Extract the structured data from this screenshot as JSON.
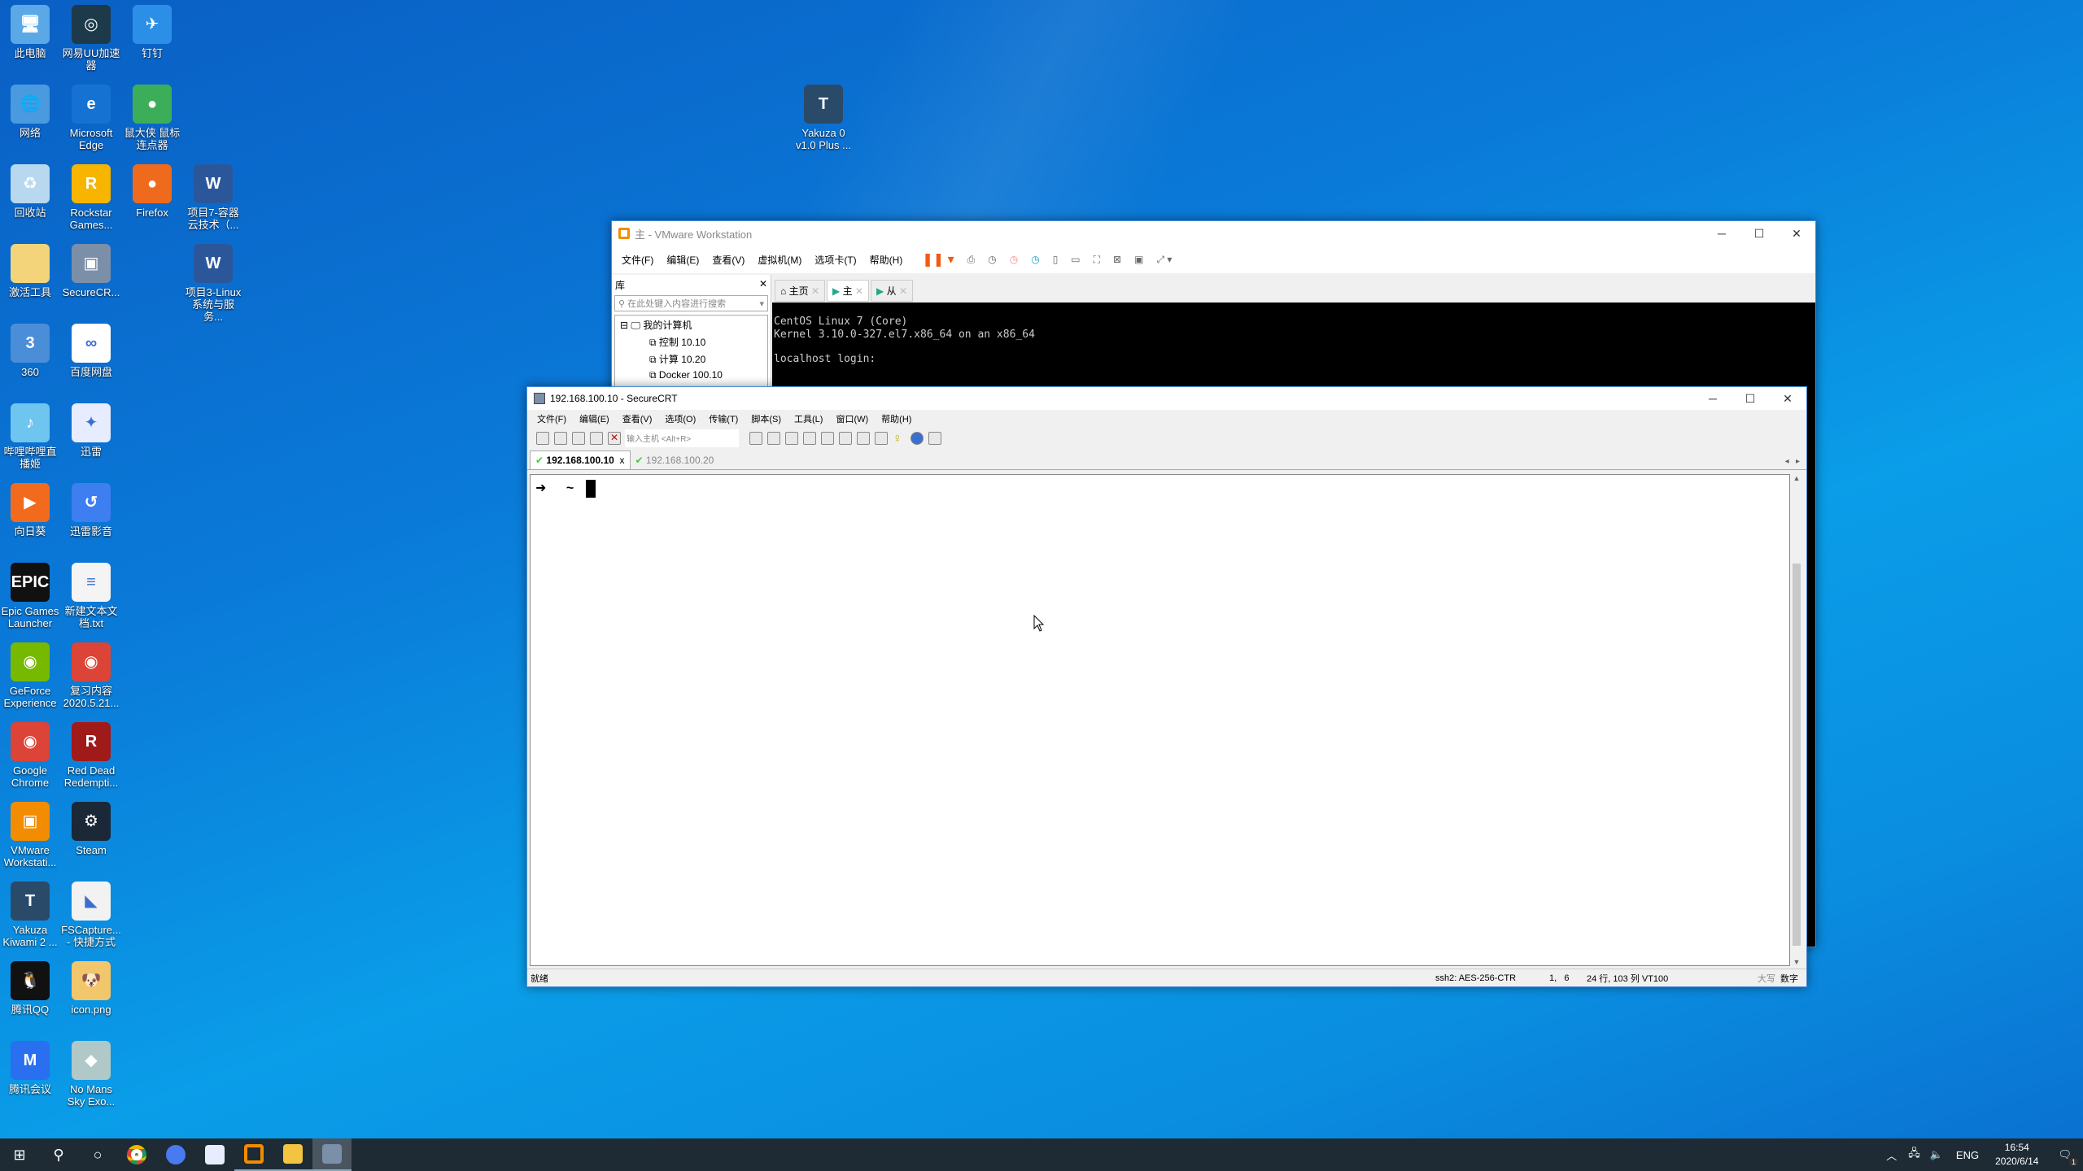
{
  "desktop": {
    "icons": [
      {
        "label": "此电脑",
        "color": "#5aa9e6",
        "glyph": "🖥"
      },
      {
        "label": "网易UU加速器",
        "color": "#1d3a4a",
        "glyph": "◎"
      },
      {
        "label": "钉钉",
        "color": "#2b8fe8",
        "glyph": "✈"
      },
      {
        "label": "网络",
        "color": "#4a9ae0",
        "glyph": "🌐"
      },
      {
        "label": "Microsoft Edge",
        "color": "#1572d3",
        "glyph": "e"
      },
      {
        "label": "鼠大侠 鼠标连点器",
        "color": "#3cae5a",
        "glyph": "●"
      },
      {
        "label": "回收站",
        "color": "#b8d8f0",
        "glyph": "♻"
      },
      {
        "label": "Rockstar Games...",
        "color": "#f7b500",
        "glyph": "R"
      },
      {
        "label": "Firefox",
        "color": "#f06a1d",
        "glyph": "●"
      },
      {
        "label": "项目7-容器云技术（...",
        "color": "#2b579a",
        "glyph": "W"
      },
      {
        "label": "激活工具",
        "color": "#f3d47a",
        "glyph": ""
      },
      {
        "label": "SecureCR...",
        "color": "#7c8fa8",
        "glyph": "▣"
      },
      {
        "label": "项目3-Linux系统与服务...",
        "color": "#2b579a",
        "glyph": "W"
      },
      {
        "label": "360",
        "color": "#4a8ed8",
        "glyph": "3"
      },
      {
        "label": "百度网盘",
        "color": "#ffffff",
        "glyph": "∞"
      },
      {
        "label": "哔哩哔哩直播姬",
        "color": "#6ec6f0",
        "glyph": "♪"
      },
      {
        "label": "迅雷",
        "color": "#e8ecff",
        "glyph": "✦"
      },
      {
        "label": "向日葵",
        "color": "#f26b1d",
        "glyph": "▶"
      },
      {
        "label": "迅雷影音",
        "color": "#3d7ef0",
        "glyph": "↺"
      },
      {
        "label": "Epic Games Launcher",
        "color": "#111111",
        "glyph": "EPIC"
      },
      {
        "label": "新建文本文档.txt",
        "color": "#f4f4f4",
        "glyph": "≡"
      },
      {
        "label": "GeForce Experience",
        "color": "#76b900",
        "glyph": "◉"
      },
      {
        "label": "复习内容2020.5.21...",
        "color": "#db4437",
        "glyph": "◉"
      },
      {
        "label": "Google Chrome",
        "color": "#db4437",
        "glyph": "◉"
      },
      {
        "label": "Red Dead Redempti...",
        "color": "#a11a1a",
        "glyph": "R"
      },
      {
        "label": "VMware Workstati...",
        "color": "#f28c00",
        "glyph": "▣"
      },
      {
        "label": "Steam",
        "color": "#1b2838",
        "glyph": "⚙"
      },
      {
        "label": "Yakuza Kiwami 2 ...",
        "color": "#2a4a6a",
        "glyph": "T"
      },
      {
        "label": "FSCapture... - 快捷方式",
        "color": "#f2f2f2",
        "glyph": "◣"
      },
      {
        "label": "腾讯QQ",
        "color": "#111111",
        "glyph": "🐧"
      },
      {
        "label": "icon.png",
        "color": "#f2c66b",
        "glyph": "🐶"
      },
      {
        "label": "腾讯会议",
        "color": "#2a6ff0",
        "glyph": "M"
      },
      {
        "label": "No Mans Sky Exo...",
        "color": "#b0c8c8",
        "glyph": "◆"
      },
      {
        "label": "Yakuza 0 v1.0 Plus ...",
        "color": "#2a4a6a",
        "glyph": "T"
      }
    ]
  },
  "vmware": {
    "title": "主 - VMware Workstation",
    "menu": [
      "文件(F)",
      "编辑(E)",
      "查看(V)",
      "虚拟机(M)",
      "选项卡(T)",
      "帮助(H)"
    ],
    "library_title": "库",
    "search_placeholder": "在此处键入内容进行搜索",
    "tree_root": "我的计算机",
    "tree_items": [
      "控制 10.10",
      "计算 10.20",
      "Docker 100.10"
    ],
    "tabs": [
      "主页",
      "主",
      "从"
    ],
    "console": [
      "CentOS Linux 7 (Core)",
      "Kernel 3.10.0-327.el7.x86_64 on an x86_64",
      "",
      "localhost login:"
    ]
  },
  "securecrt": {
    "title": "192.168.100.10 - SecureCRT",
    "menu": [
      "文件(F)",
      "编辑(E)",
      "查看(V)",
      "选项(O)",
      "传输(T)",
      "脚本(S)",
      "工具(L)",
      "窗口(W)",
      "帮助(H)"
    ],
    "host_placeholder": "输入主机 <Alt+R>",
    "tabs": [
      {
        "label": "192.168.100.10",
        "active": true
      },
      {
        "label": "192.168.100.20",
        "active": false
      }
    ],
    "prompt_arrow": "➜",
    "prompt_dir": "~",
    "status": {
      "ready": "就绪",
      "cipher": "ssh2: AES-256-CTR",
      "cursor": "1,   6",
      "size": "24 行, 103 列 VT100",
      "caps": "大写",
      "num": "数字"
    }
  },
  "taskbar": {
    "time": "16:54",
    "date": "2020/6/14",
    "lang": "ENG",
    "notifications": "1"
  }
}
